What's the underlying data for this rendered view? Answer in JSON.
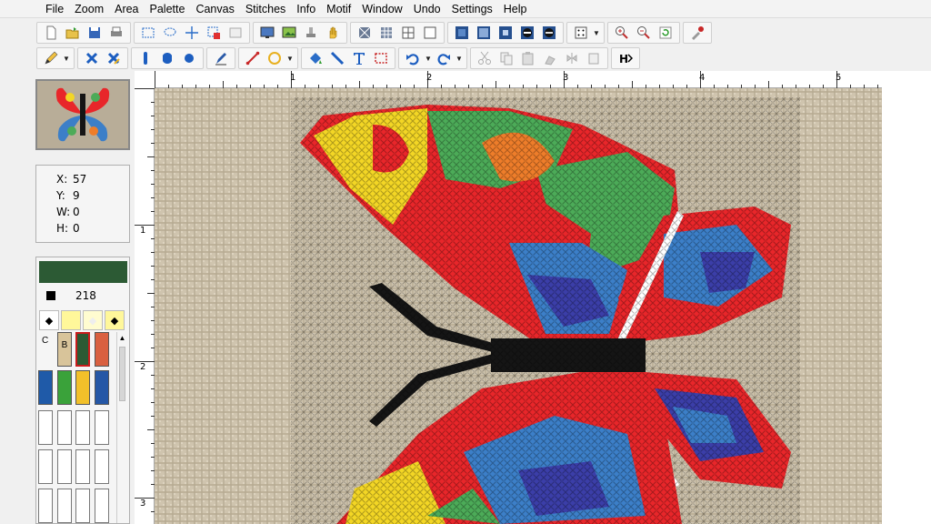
{
  "menu": [
    "File",
    "Zoom",
    "Area",
    "Palette",
    "Canvas",
    "Stitches",
    "Info",
    "Motif",
    "Window",
    "Undo",
    "Settings",
    "Help"
  ],
  "toolbar1": {
    "groups": [
      [
        "new-file-icon",
        "open-folder-icon",
        "save-icon",
        "print-icon"
      ],
      [
        "select-rectangle-icon",
        "select-lasso-icon",
        "crosshair-icon",
        "select-color-icon",
        "select-clear-icon"
      ],
      [
        "preview-screen-icon",
        "image-import-icon",
        "stamp-icon",
        "hand-pan-icon"
      ],
      [
        "view-full-stitch-icon",
        "view-pattern-icon",
        "view-grid-icon",
        "view-plain-icon"
      ],
      [
        "blue-box-1-icon",
        "blue-box-2-icon",
        "blue-box-3-icon",
        "black-circle-1-icon",
        "black-circle-2-icon"
      ],
      [
        "grid-dots-dropdown-icon"
      ],
      [
        "zoom-in-icon",
        "zoom-out-icon",
        "refresh-icon"
      ],
      [
        "color-picker-icon"
      ]
    ]
  },
  "toolbar2": {
    "groups": [
      [
        "pencil-dropdown-icon"
      ],
      [
        "delete-cross-icon",
        "fill-cross-icon"
      ],
      [
        "half-stitch-icon",
        "quarter-stitch-icon",
        "french-knot-icon"
      ],
      [
        "backstitch-pen-icon"
      ],
      [
        "line-tool-icon",
        "circle-dropdown-icon"
      ],
      [
        "fill-bucket-icon",
        "brush-line-icon",
        "text-tool-icon",
        "selection-dotted-icon"
      ],
      [
        "undo-dropdown-icon",
        "redo-dropdown-icon"
      ],
      [
        "cut-icon",
        "copy-icon",
        "paste-icon",
        "clean-icon",
        "flip-icon",
        "paste-special-icon"
      ],
      [
        "hide-next-icon"
      ]
    ]
  },
  "ruler": {
    "top_labels": [
      "1",
      "2",
      "3",
      "4",
      "5"
    ],
    "left_labels": [
      "1",
      "2",
      "3"
    ]
  },
  "info": {
    "x_label": "X:",
    "x_value": "57",
    "y_label": "Y:",
    "y_value": "9",
    "w_label": "W:",
    "w_value": "0",
    "h_label": "H:",
    "h_value": "0"
  },
  "palette": {
    "current_color_number": "218",
    "current_color": "#2c5a34",
    "column_labels": [
      "C",
      "B"
    ],
    "swatch_colors": [
      "#2c5a34",
      "#d96040",
      "#1f5aa8",
      "#3aa23a",
      "#f2c02a",
      "#2557a6"
    ],
    "tan_swatch": "#d8c49a"
  },
  "colors": {
    "fabric": "#cfc4ae",
    "red": "#e8262a",
    "yellow": "#f3d625",
    "green": "#4cab58",
    "blue": "#3c7fc8",
    "navy": "#3b3ea8",
    "orange": "#ee7d2a",
    "black": "#151515",
    "white": "#ffffff"
  }
}
